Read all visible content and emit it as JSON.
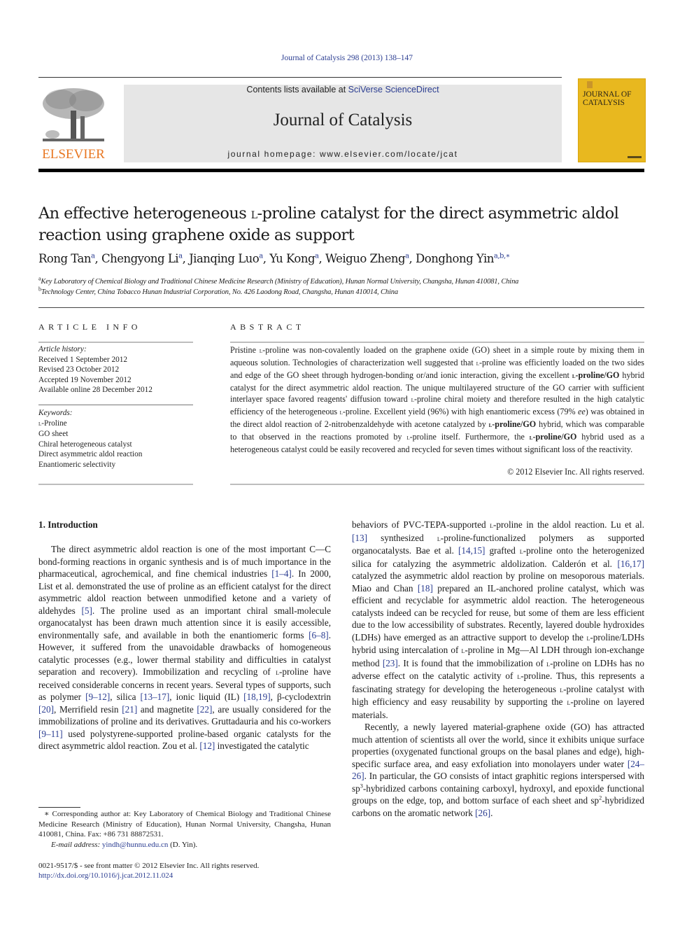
{
  "running_head": "Journal of Catalysis 298 (2013) 138–147",
  "masthead": {
    "publisher_logo_text": "ELSEVIER",
    "contents_prefix": "Contents lists available at ",
    "contents_link": "SciVerse ScienceDirect",
    "journal_name": "Journal of Catalysis",
    "homepage": "journal homepage: www.elsevier.com/locate/jcat",
    "cover_title_line1": "JOURNAL OF",
    "cover_title_line2": "CATALYSIS",
    "colors": {
      "publisher_orange": "#e87722",
      "cover_yellow": "#e8b81f",
      "link_blue": "#2b3d91",
      "banner_gray": "#e6e6e6"
    }
  },
  "article": {
    "title_part1": "An effective heterogeneous ",
    "title_smallcaps": "l",
    "title_part2": "-proline catalyst for the direct asymmetric aldol reaction using graphene oxide as support",
    "authors": [
      {
        "name": "Rong Tan",
        "sup": "a"
      },
      {
        "name": "Chengyong Li",
        "sup": "a"
      },
      {
        "name": "Jianqing Luo",
        "sup": "a"
      },
      {
        "name": "Yu Kong",
        "sup": "a"
      },
      {
        "name": "Weiguo Zheng",
        "sup": "a"
      },
      {
        "name": "Donghong Yin",
        "sup": "a,b,∗"
      }
    ],
    "affiliations": [
      {
        "mark": "a",
        "text": "Key Laboratory of Chemical Biology and Traditional Chinese Medicine Research (Ministry of Education), Hunan Normal University, Changsha, Hunan 410081, China"
      },
      {
        "mark": "b",
        "text": "Technology Center, China Tobacco Hunan Industrial Corporation, No. 426 Laodong Road, Changsha, Hunan 410014, China"
      }
    ]
  },
  "article_info": {
    "heading": "ARTICLE INFO",
    "history_label": "Article history:",
    "history": [
      "Received 1 September 2012",
      "Revised 23 October 2012",
      "Accepted 19 November 2012",
      "Available online 28 December 2012"
    ],
    "keywords_label": "Keywords:",
    "keyword_l": "l",
    "keywords": [
      "-Proline",
      "GO sheet",
      "Chiral heterogeneous catalyst",
      "Direct asymmetric aldol reaction",
      "Enantiomeric selectivity"
    ]
  },
  "abstract": {
    "heading": "ABSTRACT",
    "t1": "Pristine ",
    "t2": "-proline was non-covalently loaded on the graphene oxide (GO) sheet in a simple route by mixing them in aqueous solution. Technologies of characterization well suggested that ",
    "t3": "-proline was efficiently loaded on the two sides and edge of the GO sheet through hydrogen-bonding or/and ionic interaction, giving the excellent ",
    "b1": "-proline/GO",
    "t4": " hybrid catalyst for the direct asymmetric aldol reaction. The unique multilayered structure of the GO carrier with sufficient interlayer space favored reagents' diffusion toward ",
    "t5": "-proline chiral moiety and therefore resulted in the high catalytic efficiency of the heterogeneous ",
    "t6": "-proline. Excellent yield (96%) with high enantiomeric excess (79% ",
    "ee": "ee",
    "t7": ") was obtained in the direct aldol reaction of 2-nitrobenzaldehyde with acetone catalyzed by ",
    "t8": " hybrid, which was comparable to that observed in the reactions promoted by ",
    "t9": "-proline itself. Furthermore, the ",
    "t10": " hybrid used as a heterogeneous catalyst could be easily recovered and recycled for seven times without significant loss of the reactivity.",
    "l": "l",
    "copyright": "© 2012 Elsevier Inc. All rights reserved."
  },
  "introduction": {
    "heading": "1. Introduction",
    "left": {
      "a1": "The direct asymmetric aldol reaction is one of the most important C—C bond-forming reactions in organic synthesis and is of much importance in the pharmaceutical, agrochemical, and fine chemical industries ",
      "r1": "[1–4]",
      "a2": ". In 2000, List et al. demonstrated the use of proline as an efficient catalyst for the direct asymmetric aldol reaction between unmodified ketone and a variety of aldehydes ",
      "r2": "[5]",
      "a3": ". The proline used as an important chiral small-molecule organocatalyst has been drawn much attention since it is easily accessible, environmentally safe, and available in both the enantiomeric forms ",
      "r3": "[6–8]",
      "a4": ". However, it suffered from the unavoidable drawbacks of homogeneous catalytic processes (e.g., lower thermal stability and difficulties in catalyst separation and recovery). Immobilization and recycling of ",
      "a5": "-proline have received considerable concerns in recent years. Several types of supports, such as polymer ",
      "r4": "[9–12]",
      "a6": ", silica ",
      "r5": "[13–17]",
      "a7": ", ionic liquid (IL) ",
      "r6": "[18,19]",
      "a8": ", β-cyclodextrin ",
      "r7": "[20]",
      "a9": ", Merrifield resin ",
      "r8": "[21]",
      "a10": " and magnetite ",
      "r9": "[22]",
      "a11": ", are usually considered for the immobilizations of proline and its derivatives. Gruttadauria and his co-workers ",
      "r10": "[9–11]",
      "a12": " used polystyrene-supported proline-based organic catalysts for the direct asymmetric aldol reaction. Zou et al. ",
      "r11": "[12]",
      "a13": " investigated the catalytic"
    },
    "right": {
      "b1": "behaviors of PVC-TEPA-supported ",
      "b2": "-proline in the aldol reaction. Lu et al. ",
      "r1": "[13]",
      "b3": " synthesized ",
      "b4": "-proline-functionalized polymers as supported organocatalysts. Bae et al. ",
      "r2": "[14,15]",
      "b5": " grafted ",
      "b6": "-proline onto the heterogenized silica for catalyzing the asymmetric aldolization. Calderón et al. ",
      "r3": "[16,17]",
      "b7": " catalyzed the asymmetric aldol reaction by proline on mesoporous materials. Miao and Chan ",
      "r4": "[18]",
      "b8": " prepared an IL-anchored proline catalyst, which was efficient and recyclable for asymmetric aldol reaction. The heterogeneous catalysts indeed can be recycled for reuse, but some of them are less efficient due to the low accessibility of substrates. Recently, layered double hydroxides (LDHs) have emerged as an attractive support to develop the ",
      "b9": "-proline/LDHs hybrid using intercalation of ",
      "b10": "-proline in Mg—Al LDH through ion-exchange method ",
      "r5": "[23]",
      "b11": ". It is found that the immobilization of ",
      "b12": "-proline on LDHs has no adverse effect on the catalytic activity of ",
      "b13": "-proline. Thus, this represents a fascinating strategy for developing the heterogeneous ",
      "b14": "-proline catalyst with high efficiency and easy reusability by supporting the ",
      "b15": "-proline on layered materials.",
      "c1": "Recently, a newly layered material-graphene oxide (GO) has attracted much attention of scientists all over the world, since it exhibits unique surface properties (oxygenated functional groups on the basal planes and edge), high-specific surface area, and easy exfoliation into monolayers under water ",
      "r6": "[24–26]",
      "c2": ". In particular, the GO consists of intact graphitic regions interspersed with sp",
      "c2sup": "3",
      "c3": "-hybridized carbons containing carboxyl, hydroxyl, and epoxide functional groups on the edge, top, and bottom surface of each sheet and sp",
      "c3sup": "2",
      "c4": "-hybridized carbons on the aromatic network ",
      "r7": "[26]",
      "c5": "."
    }
  },
  "footnote": {
    "corresponding": "∗ Corresponding author at: Key Laboratory of Chemical Biology and Traditional Chinese Medicine Research (Ministry of Education), Hunan Normal University, Changsha, Hunan 410081, China. Fax: +86 731 88872531.",
    "email_label": "E-mail address: ",
    "email": "yindh@hunnu.edu.cn",
    "email_suffix": " (D. Yin).",
    "front_matter": "0021-9517/$ - see front matter © 2012 Elsevier Inc. All rights reserved.",
    "doi": "http://dx.doi.org/10.1016/j.jcat.2012.11.024"
  }
}
